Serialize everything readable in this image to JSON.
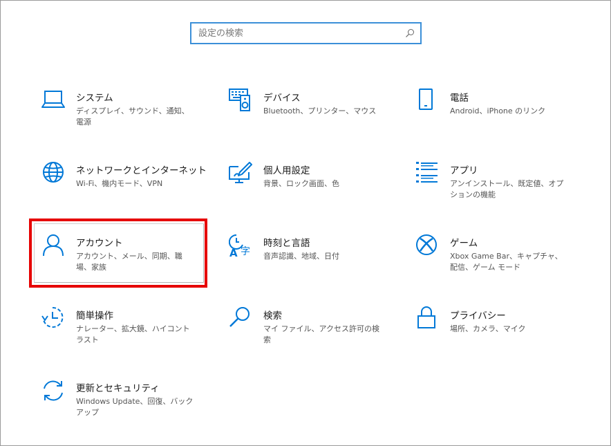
{
  "search": {
    "placeholder": "設定の検索"
  },
  "tiles": [
    {
      "title": "システム",
      "desc": "ディスプレイ、サウンド、通知、電源",
      "icon": "laptop-icon"
    },
    {
      "title": "デバイス",
      "desc": "Bluetooth、プリンター、マウス",
      "icon": "keyboard-speaker-icon"
    },
    {
      "title": "電話",
      "desc": "Android、iPhone のリンク",
      "icon": "phone-icon"
    },
    {
      "title": "ネットワークとインターネット",
      "desc": "Wi-Fi、機内モード、VPN",
      "icon": "globe-icon"
    },
    {
      "title": "個人用設定",
      "desc": "背景、ロック画面、色",
      "icon": "paint-display-icon"
    },
    {
      "title": "アプリ",
      "desc": "アンインストール、既定値、オプションの機能",
      "icon": "app-list-icon"
    },
    {
      "title": "アカウント",
      "desc": "アカウント、メール、同期、職場、家族",
      "icon": "person-icon"
    },
    {
      "title": "時刻と言語",
      "desc": "音声認識、地域、日付",
      "icon": "time-language-icon"
    },
    {
      "title": "ゲーム",
      "desc": "Xbox Game Bar、キャプチャ、配信、ゲーム モード",
      "icon": "xbox-icon"
    },
    {
      "title": "簡単操作",
      "desc": "ナレーター、拡大鏡、ハイコントラスト",
      "icon": "ease-of-access-icon"
    },
    {
      "title": "検索",
      "desc": "マイ ファイル、アクセス許可の検索",
      "icon": "search-magnifier-icon"
    },
    {
      "title": "プライバシー",
      "desc": "場所、カメラ、マイク",
      "icon": "lock-icon"
    },
    {
      "title": "更新とセキュリティ",
      "desc": "Windows Update、回復、バックアップ",
      "icon": "sync-icon"
    }
  ],
  "colors": {
    "accent": "#0078d7",
    "highlight": "#e60000",
    "search_border": "#3b8fd8"
  }
}
